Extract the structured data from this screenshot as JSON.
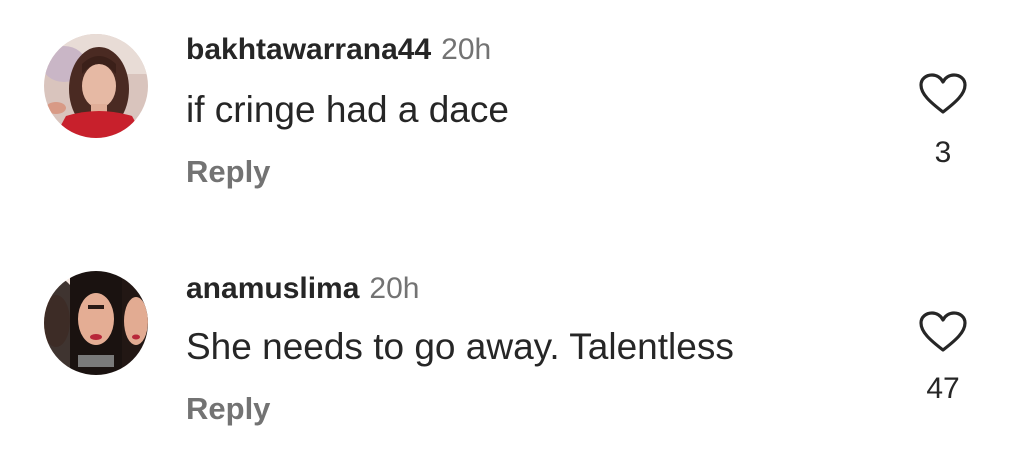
{
  "comments": [
    {
      "username": "bakhtawarrana44",
      "time": "20h",
      "text": "if cringe had a dace",
      "reply_label": "Reply",
      "likes": "3",
      "avatar": "profile-photo"
    },
    {
      "username": "anamuslima",
      "time": "20h",
      "text": "She needs to go away. Talentless",
      "reply_label": "Reply",
      "likes": "47",
      "avatar": "profile-photo"
    }
  ],
  "colors": {
    "text_primary": "#262626",
    "text_secondary": "#737373",
    "background": "#ffffff"
  },
  "icons": {
    "like": "heart-outline-icon"
  }
}
